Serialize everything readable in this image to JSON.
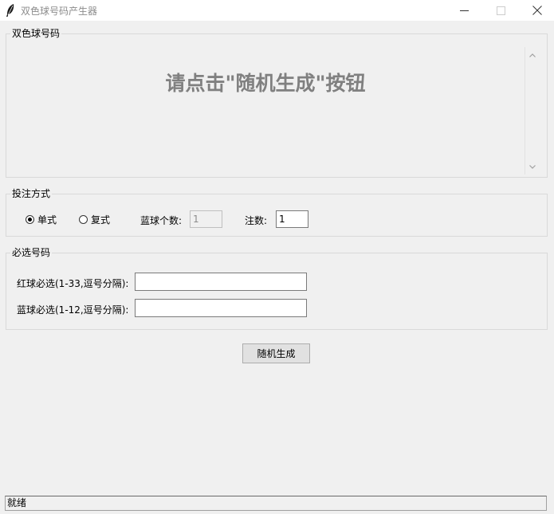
{
  "window": {
    "title": "双色球号码产生器",
    "controls": {
      "minimize": "—",
      "maximize": "☐",
      "close": "✕"
    }
  },
  "result_group": {
    "label": "双色球号码",
    "prompt_text": "请点击\"随机生成\"按钮",
    "scroll_up": "^",
    "scroll_down": "v"
  },
  "bet_group": {
    "label": "投注方式",
    "single_label": "单式",
    "multiple_label": "复式",
    "selected": "单式",
    "blue_count_label": "蓝球个数:",
    "blue_count_value": "1",
    "bets_label": "注数:",
    "bets_value": "1"
  },
  "must_pick_group": {
    "label": "必选号码",
    "red_label": "红球必选(1-33,逗号分隔):",
    "red_value": "",
    "blue_label": "蓝球必选(1-12,逗号分隔):",
    "blue_value": ""
  },
  "generate_button": {
    "label": "随机生成"
  },
  "status_bar": {
    "text": "就绪"
  }
}
